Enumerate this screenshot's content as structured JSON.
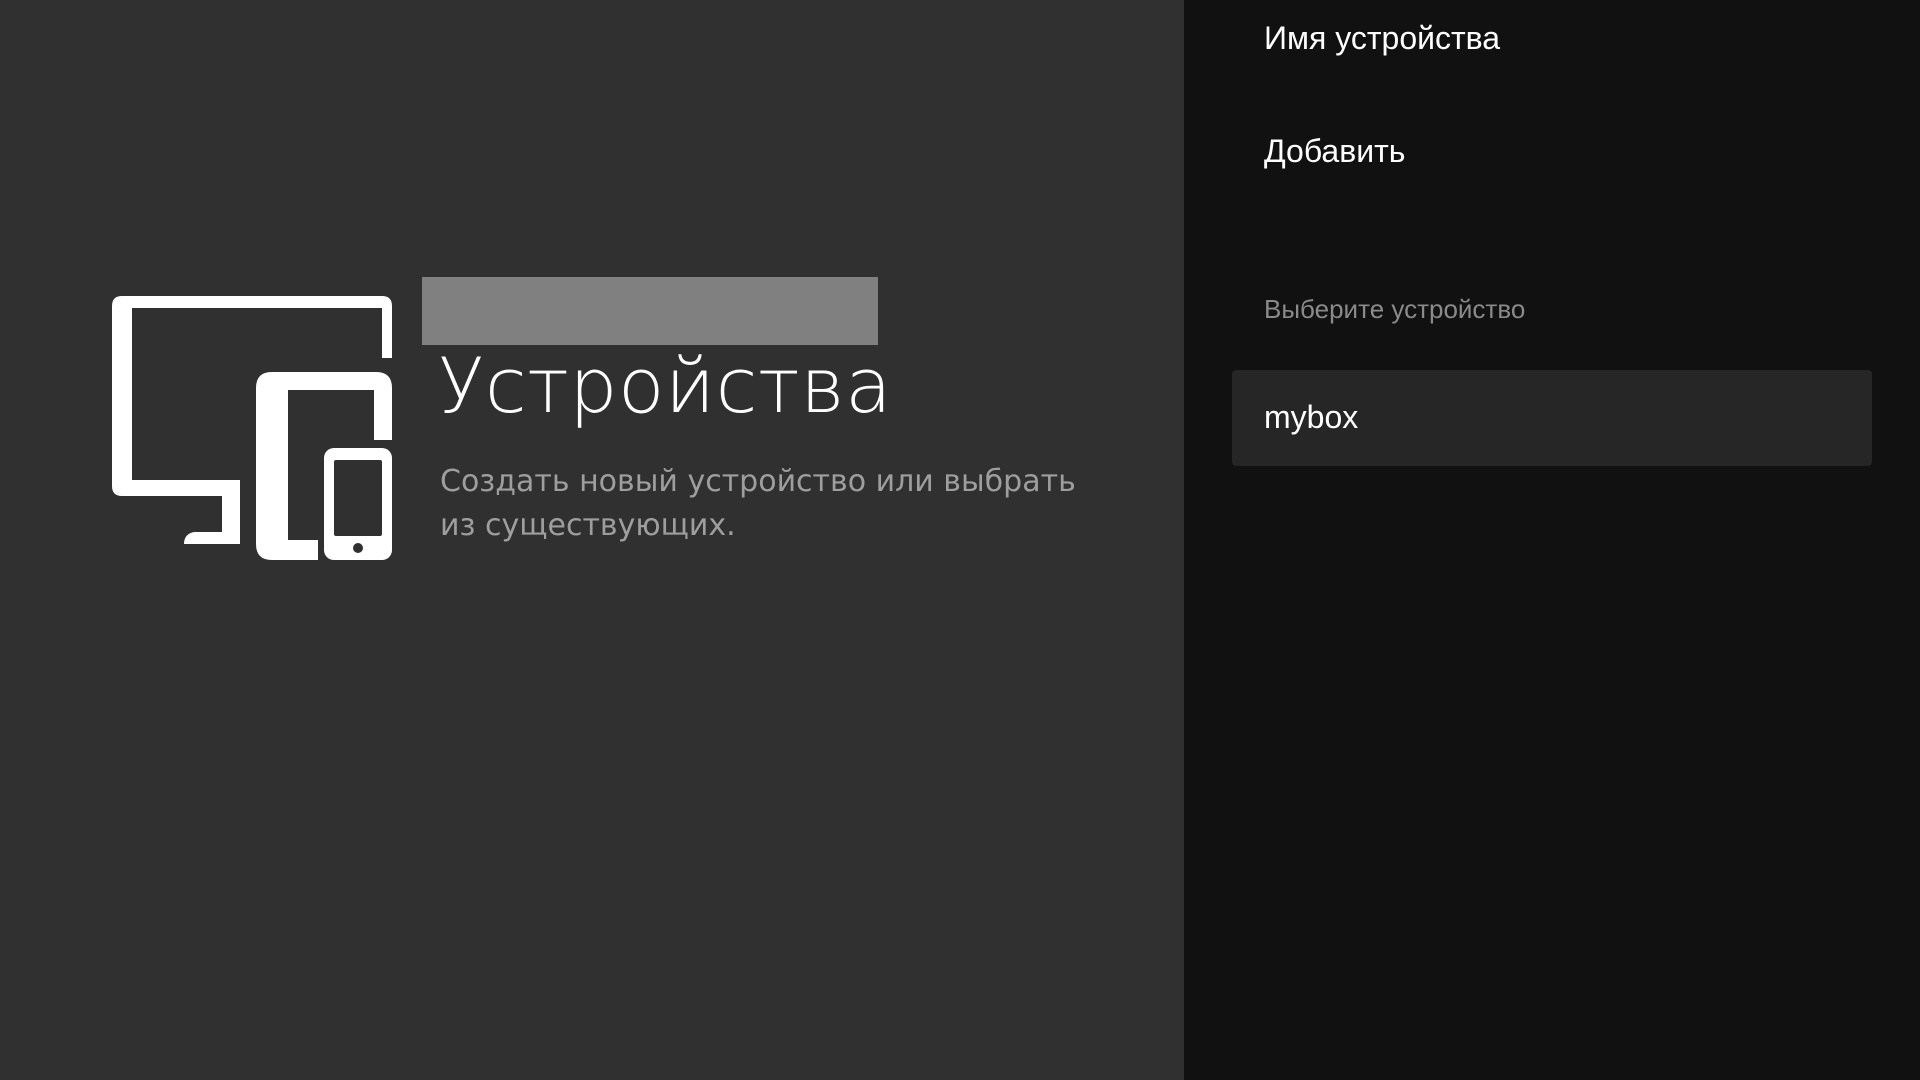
{
  "guidance": {
    "icon": "devices-icon",
    "title": "Устройства",
    "description": "Создать новый устройство или выбрать из существующих."
  },
  "actions": {
    "items": [
      {
        "label": "Имя устройства"
      },
      {
        "label": "Добавить"
      }
    ]
  },
  "device_list": {
    "header": "Выберите устройство",
    "items": [
      {
        "label": "mybox"
      }
    ]
  },
  "colors": {
    "left_background": "#303030",
    "right_background": "#111111",
    "selected_item_background": "#262626",
    "title_block": "#808080",
    "text_primary": "#ffffff",
    "text_secondary": "#9e9e9e"
  }
}
